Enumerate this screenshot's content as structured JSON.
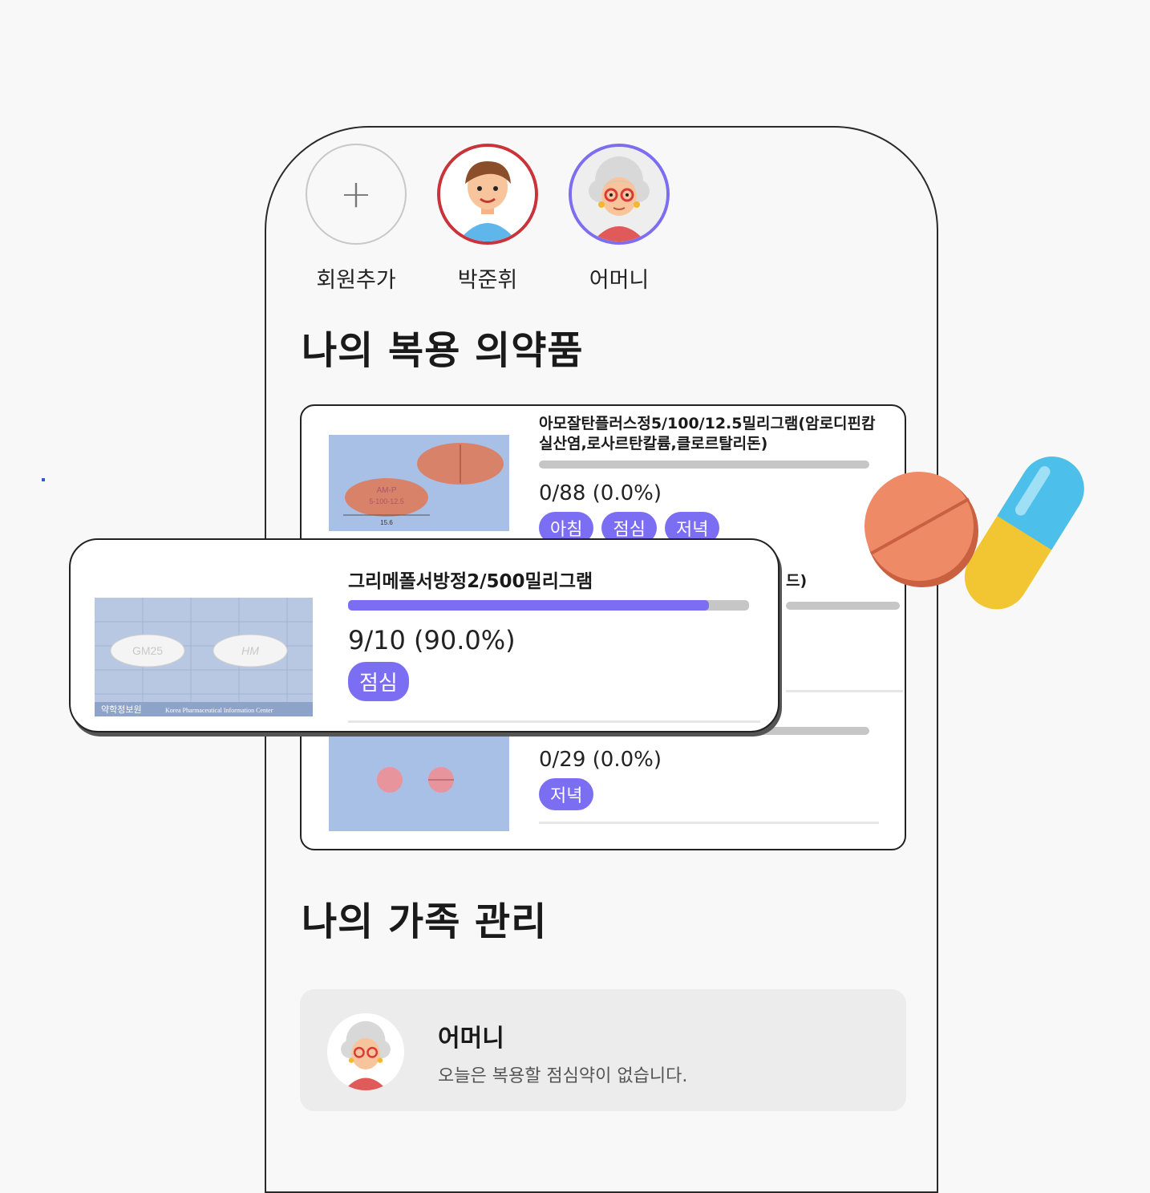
{
  "avatars": [
    {
      "label": "회원추가",
      "type": "add"
    },
    {
      "label": "박준휘",
      "type": "user"
    },
    {
      "label": "어머니",
      "type": "mother"
    }
  ],
  "my_medicines": {
    "title": "나의 복용 의약품",
    "items": [
      {
        "name": "아모잘탄플러스정5/100/12.5밀리그램(암로디핀캄실산염,로사르탄칼륨,클로르탈리돈)",
        "progress": 0.0,
        "count": "0/88 (0.0%)",
        "tags": [
          "아침",
          "점심",
          "저녁"
        ],
        "image_texts": [
          "AM-P",
          "5-100-12.5",
          "15.6"
        ]
      },
      {
        "name_fragment": "드)"
      },
      {
        "count": "0/29 (0.0%)",
        "progress": 0.0,
        "tags": [
          "저녁"
        ]
      }
    ]
  },
  "popup": {
    "name": "그리메폴서방정2/500밀리그램",
    "progress": 0.9,
    "count": "9/10 (90.0%)",
    "tags": [
      "점심"
    ],
    "image_texts": [
      "GM25",
      "HM",
      "약학정보원",
      "Korea Pharmaceutical Information Center"
    ]
  },
  "family": {
    "title": "나의 가족 관리",
    "member": {
      "name": "어머니",
      "message": "오늘은 복용할 점심약이 없습니다."
    }
  },
  "colors": {
    "accent": "#7b6ef2",
    "user_ring": "#c9343a",
    "mother_ring": "#7d6ef0"
  }
}
